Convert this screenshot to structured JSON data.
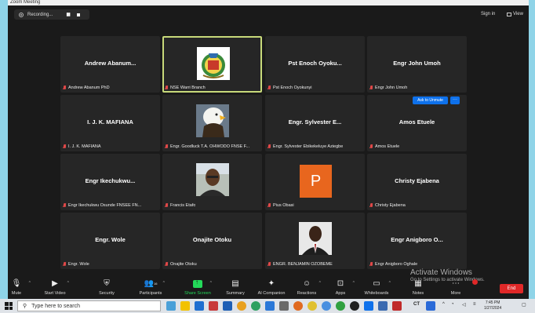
{
  "window": {
    "title": "Zoom Meeting"
  },
  "topbar": {
    "recording_label": "Recording...",
    "sign_in": "Sign in",
    "view": "View"
  },
  "tiles": [
    {
      "name": "Andrew  Abanum...",
      "label": "Andrew Abanum PhD"
    },
    {
      "name": "",
      "label": "NSE Warri Branch"
    },
    {
      "name": "Pst Enoch Oyoku...",
      "label": "Pst Enoch Oyokunyi"
    },
    {
      "name": "Engr John Umoh",
      "label": "Engr John Umoh"
    },
    {
      "name": "I. J. K. MAFIANA",
      "label": "I. J. K. MAFIANA"
    },
    {
      "name": "",
      "label": "Engr. Goodluck T.A. OHWODO FNSE F..."
    },
    {
      "name": "Engr. Sylvester E...",
      "label": "Engr. Sylvester Ebikekeluye Aziegbe"
    },
    {
      "name": "Amos Etuele",
      "label": "Amos Etuele"
    },
    {
      "name": "Engr  Ikechukwu...",
      "label": "Engr Ikechukwu Osunde FNSEE FN..."
    },
    {
      "name": "",
      "label": "Francis Etafo"
    },
    {
      "name": "",
      "label": "Pius Obasi"
    },
    {
      "name": "Christy Ejabena",
      "label": "Christy Ejabena"
    },
    {
      "name": "Engr. Wole",
      "label": "Engr. Wole"
    },
    {
      "name": "Onajite Otoku",
      "label": "Onajite Otoku"
    },
    {
      "name": "",
      "label": "ENGR. BENJAMIN OZOBEME"
    },
    {
      "name": "Engr  Anigboro O...",
      "label": "Engr Anigboro Oghale"
    }
  ],
  "pius_initial": "P",
  "ask_to_unmute": "Ask to Unmute",
  "more_dots": "···",
  "controls": {
    "mute": "Mute",
    "start_video": "Start Video",
    "security": "Security",
    "participants": "Participants",
    "participants_count": "16",
    "share_screen": "Share Screen",
    "summary": "Summary",
    "ai_companion": "AI Companion",
    "reactions": "Reactions",
    "apps": "Apps",
    "whiteboards": "Whiteboards",
    "notes": "Notes",
    "more": "More",
    "end": "End"
  },
  "watermark": {
    "title": "Activate Windows",
    "subtitle": "Go to Settings to activate Windows."
  },
  "taskbar": {
    "search_placeholder": "Type here to search",
    "tray_ct": "CT",
    "time": "7:45 PM",
    "date": "1/27/2024"
  },
  "colors": {
    "accent": "#0e71eb",
    "share_green": "#23d959",
    "end_red": "#e02828",
    "active_border": "#c8d97a"
  }
}
